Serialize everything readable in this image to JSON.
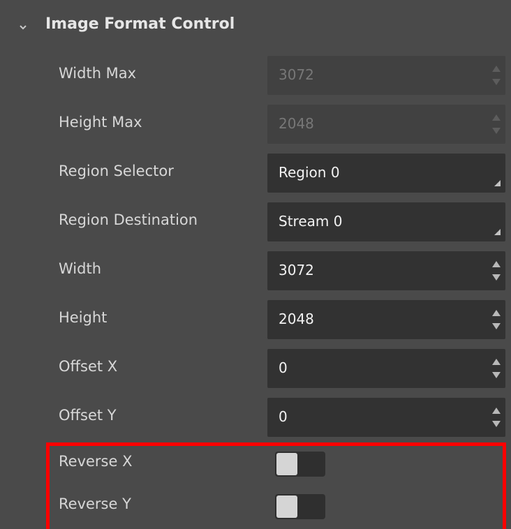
{
  "group": {
    "title": "Image Format Control",
    "expanded": true
  },
  "fields": [
    {
      "label": "Width Max",
      "value": "3072",
      "type": "spin",
      "enabled": false
    },
    {
      "label": "Height Max",
      "value": "2048",
      "type": "spin",
      "enabled": false
    },
    {
      "label": "Region Selector",
      "value": "Region 0",
      "type": "combo",
      "enabled": true
    },
    {
      "label": "Region Destination",
      "value": "Stream 0",
      "type": "combo",
      "enabled": true
    },
    {
      "label": "Width",
      "value": "3072",
      "type": "spin",
      "enabled": true
    },
    {
      "label": "Height",
      "value": "2048",
      "type": "spin",
      "enabled": true
    },
    {
      "label": "Offset X",
      "value": "0",
      "type": "spin",
      "enabled": true
    },
    {
      "label": "Offset Y",
      "value": "0",
      "type": "spin",
      "enabled": true
    }
  ],
  "toggles": [
    {
      "label": "Reverse X",
      "on": false
    },
    {
      "label": "Reverse Y",
      "on": false
    }
  ],
  "colors": {
    "background": "#4a4a4a",
    "field": "#323232",
    "highlight": "#ff0000"
  }
}
